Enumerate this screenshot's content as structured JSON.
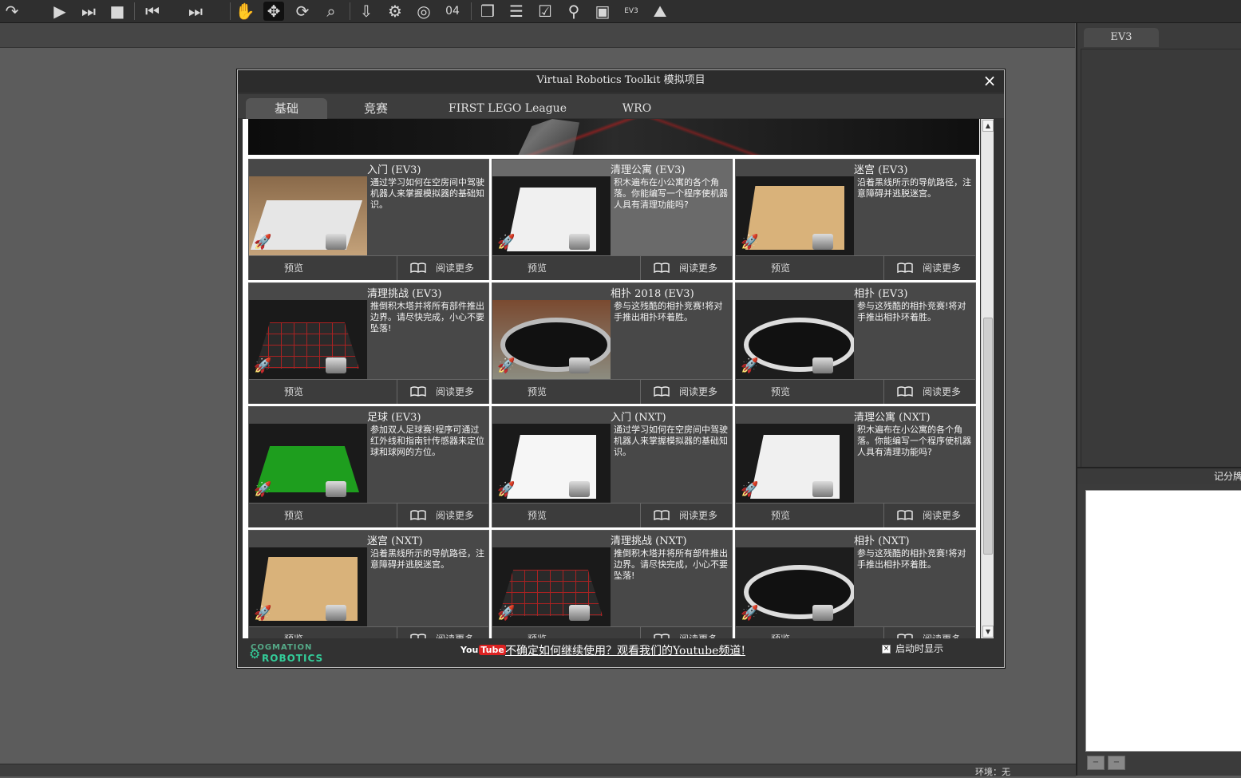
{
  "toolbar": {
    "icons": [
      "redo-icon",
      "play-icon",
      "step-icon",
      "stop-icon",
      "rewind-icon",
      "skip-icon",
      "hand-icon",
      "move-icon",
      "rotate-icon",
      "zoom-icon",
      "import-icon",
      "gear-icon",
      "target-icon",
      "counter-icon",
      "box-icon",
      "layers-icon",
      "checklist-icon",
      "pin-icon",
      "save-icon",
      "ev3-icon",
      "mountain-icon"
    ],
    "counter_label": "04",
    "ev3_label": "EV3"
  },
  "right_panel": {
    "tab": "EV3",
    "score_header": "记分牌",
    "status": "环境：无"
  },
  "dialog": {
    "title": "Virtual Robotics Toolkit 模拟项目",
    "close": "×",
    "tabs": [
      {
        "label": "基础",
        "active": true
      },
      {
        "label": "竞赛",
        "active": false
      },
      {
        "label": "FIRST LEGO League",
        "active": false
      },
      {
        "label": "WRO",
        "active": false
      }
    ],
    "preview_label": "预览",
    "read_more_label": "阅读更多",
    "cards": [
      {
        "title": "入门 (EV3)",
        "desc": "通过学习如何在空房间中驾驶机器人来掌握模拟器的基础知识。",
        "thumb": "intro"
      },
      {
        "title": "清理公寓 (EV3)",
        "desc": "积木遍布在小公寓的各个角落。你能编写一个程序使机器人具有清理功能吗?",
        "thumb": "room",
        "highlighted": true
      },
      {
        "title": "迷宫 (EV3)",
        "desc": "沿着黑线所示的导航路径，注意障碍并逃脱迷宫。",
        "thumb": "maze"
      },
      {
        "title": "清理挑战 (EV3)",
        "desc": "推倒积木塔并将所有部件推出边界。请尽快完成，小心不要坠落!",
        "thumb": "grid"
      },
      {
        "title": "相扑 2018 (EV3)",
        "desc": "参与这残酷的相扑竞赛!将对手推出相扑环着胜。",
        "thumb": "sumo2018"
      },
      {
        "title": "相扑 (EV3)",
        "desc": "参与这残酷的相扑竞赛!将对手推出相扑环着胜。",
        "thumb": "ring"
      },
      {
        "title": "足球 (EV3)",
        "desc": "参加双人足球赛!程序可通过红外线和指南针传感器来定位球和球网的方位。",
        "thumb": "soccer"
      },
      {
        "title": "入门 (NXT)",
        "desc": "通过学习如何在空房间中驾驶机器人来掌握模拟器的基础知识。",
        "thumb": "empty"
      },
      {
        "title": "清理公寓 (NXT)",
        "desc": "积木遍布在小公寓的各个角落。你能编写一个程序使机器人具有清理功能吗?",
        "thumb": "room"
      },
      {
        "title": "迷宫 (NXT)",
        "desc": "沿着黑线所示的导航路径，注意障碍并逃脱迷宫。",
        "thumb": "maze"
      },
      {
        "title": "清理挑战 (NXT)",
        "desc": "推倒积木塔并将所有部件推出边界。请尽快完成，小心不要坠落!",
        "thumb": "grid"
      },
      {
        "title": "相扑 (NXT)",
        "desc": "参与这残酷的相扑竞赛!将对手推出相扑环着胜。",
        "thumb": "ring"
      }
    ],
    "footer": {
      "logo_top": "COGMATION",
      "logo_bottom": "ROBOTICS",
      "youtube_you": "You",
      "youtube_tube": "Tube",
      "youtube_link": "不确定如何继续使用？观看我们的Youtube频道!",
      "startup_checkbox": "启动时显示",
      "startup_checked": true,
      "checkbox_mark": "×"
    }
  }
}
